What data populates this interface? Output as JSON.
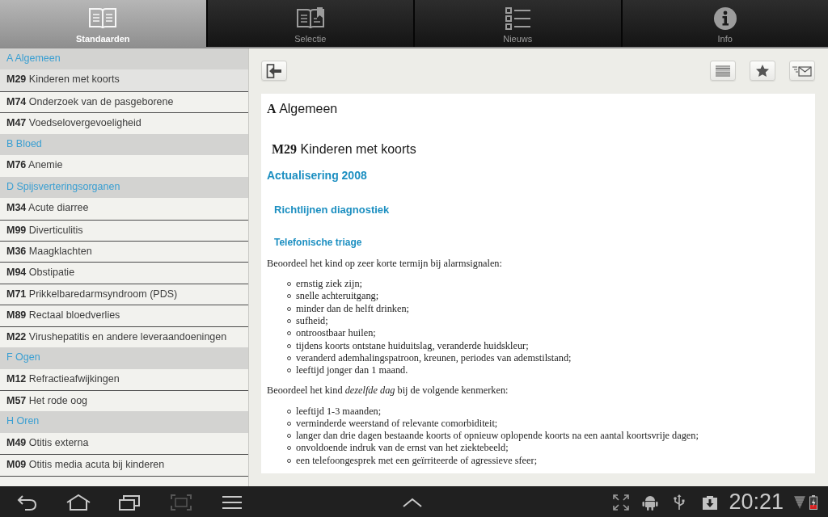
{
  "tabs": [
    {
      "label": "Standaarden",
      "selected": true
    },
    {
      "label": "Selectie",
      "selected": false
    },
    {
      "label": "Nieuws",
      "selected": false
    },
    {
      "label": "Info",
      "selected": false
    }
  ],
  "sidebar": {
    "items": [
      {
        "kind": "header",
        "text": "A Algemeen",
        "selected": false
      },
      {
        "kind": "item",
        "text": "**M29** Kinderen met koorts",
        "selected": true
      },
      {
        "kind": "item",
        "text": "**M74** Onderzoek van de pasgeborene",
        "selected": false
      },
      {
        "kind": "item",
        "text": "**M47** Voedselovergevoeligheid",
        "selected": false
      },
      {
        "kind": "header",
        "text": "B Bloed",
        "selected": false
      },
      {
        "kind": "item",
        "text": "**M76** Anemie",
        "selected": false
      },
      {
        "kind": "header",
        "text": "D Spijsverteringsorganen",
        "selected": false
      },
      {
        "kind": "item",
        "text": "**M34** Acute diarree",
        "selected": false
      },
      {
        "kind": "item",
        "text": "**M99** Diverticulitis",
        "selected": false
      },
      {
        "kind": "item",
        "text": "**M36** Maagklachten",
        "selected": false
      },
      {
        "kind": "item",
        "text": "**M94** Obstipatie",
        "selected": false
      },
      {
        "kind": "item",
        "text": "**M71** Prikkelbaredarmsyndroom (PDS)",
        "selected": false
      },
      {
        "kind": "item",
        "text": "**M89** Rectaal bloedverlies",
        "selected": false
      },
      {
        "kind": "item",
        "text": "**M22** Virushepatitis en andere leveraandoeningen",
        "selected": false
      },
      {
        "kind": "header",
        "text": "F Ogen",
        "selected": false
      },
      {
        "kind": "item",
        "text": "**M12** Refractieafwijkingen",
        "selected": false
      },
      {
        "kind": "item",
        "text": "**M57** Het rode oog",
        "selected": false
      },
      {
        "kind": "header",
        "text": "H Oren",
        "selected": false
      },
      {
        "kind": "item",
        "text": "**M49** Otitis externa",
        "selected": false
      },
      {
        "kind": "item",
        "text": "**M09** Otitis media acuta bij kinderen",
        "selected": false
      }
    ]
  },
  "document": {
    "blocks": [
      {
        "kind": "chapter",
        "text": "**A** Algemeen"
      },
      {
        "kind": "standard",
        "text": "**M29** Kinderen met koorts"
      },
      {
        "kind": "h1",
        "text": "Actualisering 2008"
      },
      {
        "kind": "h2",
        "text": "Richtlijnen diagnostiek"
      },
      {
        "kind": "h3",
        "text": "Telefonische triage"
      },
      {
        "kind": "paragraph",
        "text": "Beoordeel het kind op zeer korte termijn bij alarmsignalen:"
      },
      {
        "kind": "list",
        "items": [
          "ernstig ziek zijn;",
          "snelle achteruitgang;",
          "minder dan de helft drinken;",
          "sufheid;",
          "ontroostbaar huilen;",
          "tijdens koorts ontstane huiduitslag, veranderde huidskleur;",
          "veranderd ademhalingspatroon, kreunen, periodes van ademstilstand;",
          "leeftijd jonger dan 1 maand."
        ]
      },
      {
        "kind": "paragraph",
        "text": "Beoordeel het kind *dezelfde dag* bij de volgende kenmerken:"
      },
      {
        "kind": "list",
        "items": [
          "leeftijd 1-3 maanden;",
          "verminderde weerstand of relevante comorbiditeit;",
          "langer dan drie dagen bestaande koorts of opnieuw oplopende koorts na een aantal koortsvrije dagen;",
          "onvoldoende indruk van de ernst van het ziektebeeld;",
          "een telefoongesprek met een geïrriteerde of agressieve sfeer;"
        ]
      }
    ]
  },
  "status_bar": {
    "time": "20:21"
  }
}
